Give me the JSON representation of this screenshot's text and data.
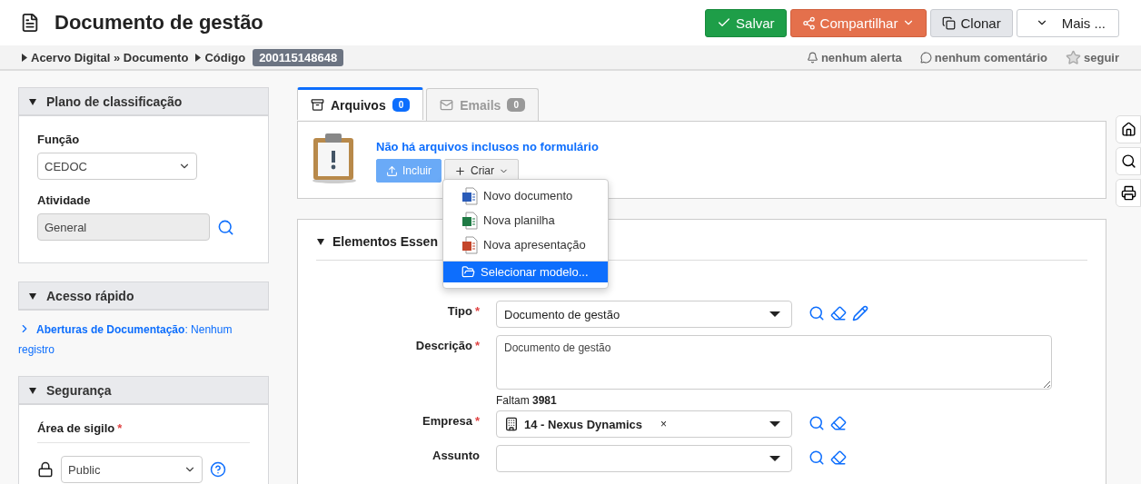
{
  "page": {
    "title": "Documento de gestão"
  },
  "actions": [
    {
      "kind": "save",
      "label": "Salvar"
    },
    {
      "kind": "share",
      "label": "Compartilhar"
    },
    {
      "kind": "clone",
      "label": "Clonar"
    },
    {
      "kind": "more",
      "label": "Mais ..."
    }
  ],
  "breadcrumb": [
    {
      "text": "Acervo Digital » Documento"
    },
    {
      "text": "Código",
      "badge": "200115148648"
    }
  ],
  "meta": [
    {
      "kind": "alert",
      "label": "nenhum alerta"
    },
    {
      "kind": "comment",
      "label": "nenhum comentário"
    },
    {
      "kind": "follow",
      "label": "seguir"
    }
  ],
  "sidebar": [
    {
      "kind": "classification",
      "title": "Plano de classificação",
      "expanded": true,
      "fields": [
        {
          "label": "Função",
          "kind": "select",
          "value": "CEDOC"
        },
        {
          "label": "Atividade",
          "kind": "readonly",
          "value": "General"
        }
      ]
    },
    {
      "kind": "quick",
      "title": "Acesso rápido",
      "expanded": true,
      "link": "**Aberturas de Documentação**: Nenhum registro"
    },
    {
      "kind": "security",
      "title": "Segurança",
      "expanded": true,
      "fields": [
        {
          "label": "Área de sigilo",
          "kind": "secure-select",
          "required_mark": "*",
          "value": "Public"
        }
      ]
    }
  ],
  "tabs": [
    {
      "label": "Arquivos",
      "count": "0",
      "selected": true
    },
    {
      "label": "Emails",
      "count": "0",
      "selected": false
    }
  ],
  "files": {
    "message": "Não há arquivos inclusos no formulário",
    "buttons": [
      {
        "kind": "upload",
        "label": "Incluir"
      },
      {
        "kind": "create",
        "label": "Criar"
      }
    ]
  },
  "create_menu": [
    {
      "kind": "word",
      "label": "Novo documento",
      "selected": false
    },
    {
      "kind": "excel",
      "label": "Nova planilha",
      "selected": false
    },
    {
      "kind": "powerpoint",
      "label": "Nova apresentação",
      "selected": false
    },
    {
      "kind": "template",
      "label": "Selecionar modelo...",
      "selected": true
    }
  ],
  "section": {
    "title": "Elementos Essen",
    "expanded": true,
    "fields": [
      {
        "kind": "select",
        "label": "Tipo",
        "required_mark": "*",
        "value": "Documento de gestão",
        "searchable": true,
        "clearable": true,
        "editable": true
      },
      {
        "kind": "textarea",
        "label": "Descrição",
        "required_mark": "*",
        "value": "Documento de gestão",
        "hint": "Faltam **3981**"
      },
      {
        "kind": "tag-select",
        "label": "Empresa",
        "required_mark": "*",
        "value": "14 - Nexus Dynamics",
        "tag_remove": "×",
        "searchable": true,
        "clearable": true
      },
      {
        "kind": "select",
        "label": "Assunto",
        "searchable": true,
        "clearable": true
      }
    ]
  }
}
